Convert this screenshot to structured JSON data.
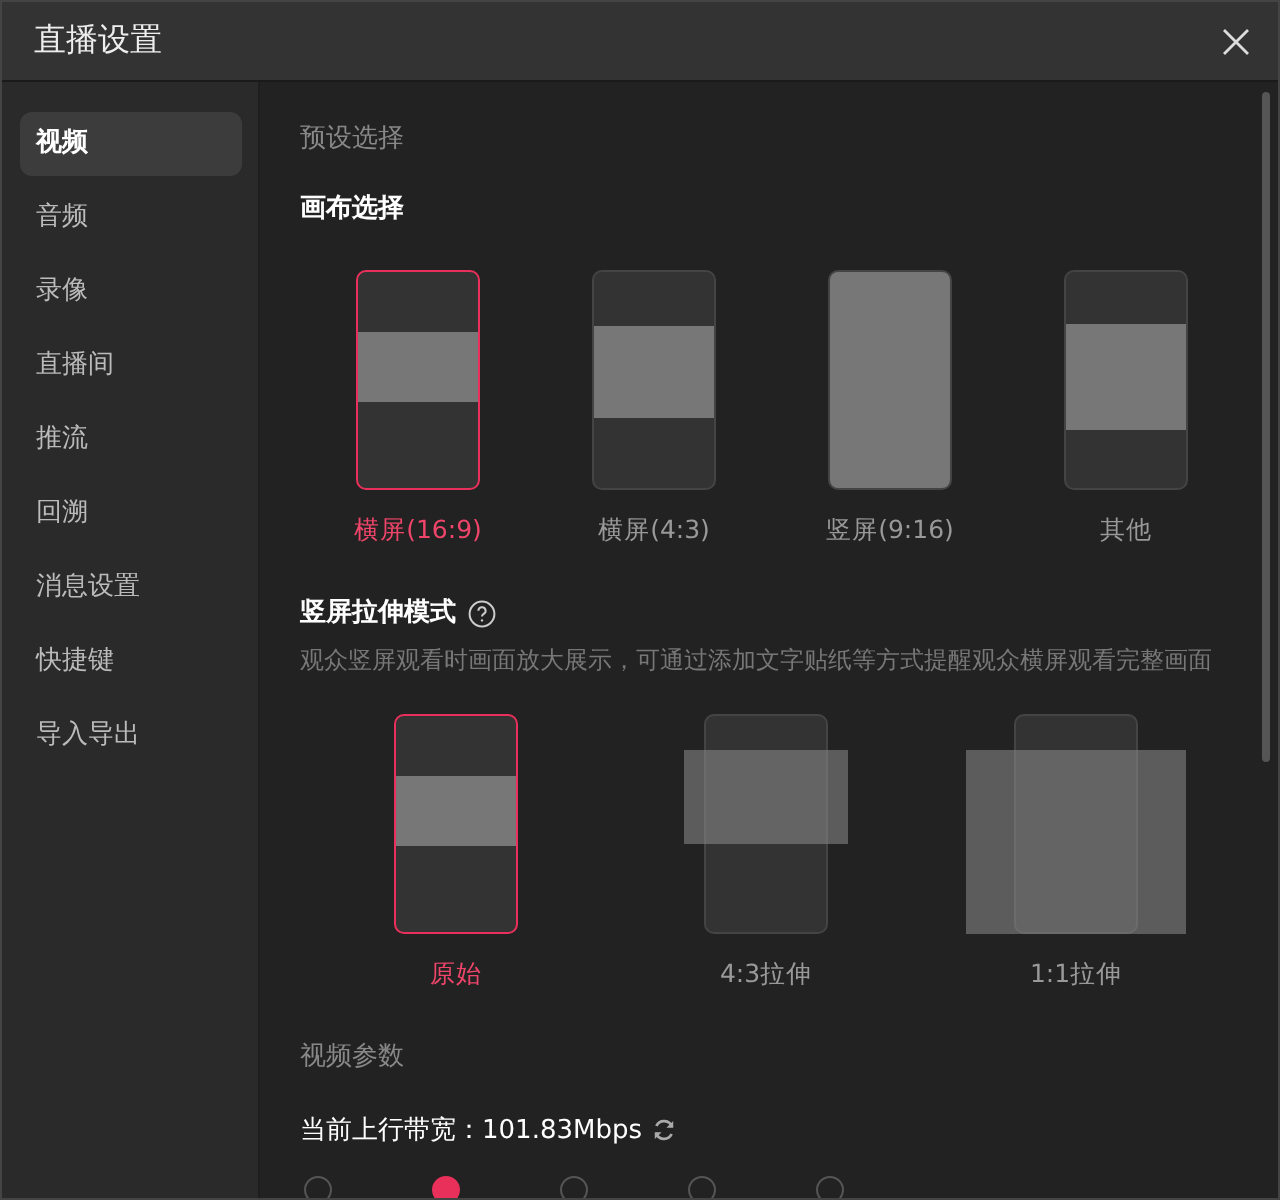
{
  "window": {
    "title": "直播设置"
  },
  "sidebar": {
    "items": [
      {
        "label": "视频",
        "selected": true
      },
      {
        "label": "音频",
        "selected": false
      },
      {
        "label": "录像",
        "selected": false
      },
      {
        "label": "直播间",
        "selected": false
      },
      {
        "label": "推流",
        "selected": false
      },
      {
        "label": "回溯",
        "selected": false
      },
      {
        "label": "消息设置",
        "selected": false
      },
      {
        "label": "快捷键",
        "selected": false
      },
      {
        "label": "导入导出",
        "selected": false
      }
    ]
  },
  "preset_heading": "预设选择",
  "canvas": {
    "title": "画布选择",
    "options": [
      {
        "label": "横屏(16:9)",
        "kind": "wide",
        "selected": true
      },
      {
        "label": "横屏(4:3)",
        "kind": "standard",
        "selected": false
      },
      {
        "label": "竖屏(9:16)",
        "kind": "portrait",
        "selected": false
      },
      {
        "label": "其他",
        "kind": "other",
        "selected": false
      }
    ]
  },
  "stretch": {
    "title": "竖屏拉伸模式",
    "description": "观众竖屏观看时画面放大展示，可通过添加文字贴纸等方式提醒观众横屏观看完整画面",
    "options": [
      {
        "label": "原始",
        "kind": "original",
        "selected": true
      },
      {
        "label": "4:3拉伸",
        "kind": "stretch43",
        "selected": false
      },
      {
        "label": "1:1拉伸",
        "kind": "stretch11",
        "selected": false
      }
    ]
  },
  "video_params": {
    "title": "视频参数",
    "bandwidth_label": "当前上行带宽：",
    "bandwidth_value": "101.83Mbps",
    "quality": [
      {
        "selected": false
      },
      {
        "selected": true
      },
      {
        "selected": false
      },
      {
        "selected": false
      },
      {
        "selected": false
      }
    ]
  }
}
